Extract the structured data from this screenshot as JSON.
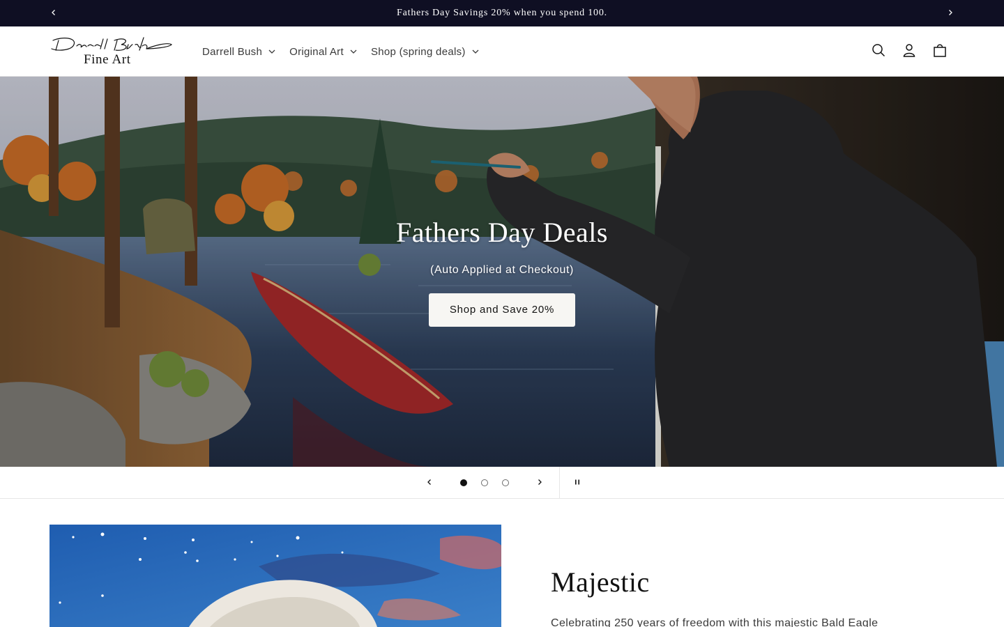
{
  "announcement": {
    "text": "Fathers Day Savings 20% when you spend 100.",
    "prev_icon": "chevron-left-icon",
    "next_icon": "chevron-right-icon"
  },
  "header": {
    "logo_script": "Darrell Bush",
    "logo_text": "Fine Art",
    "nav": [
      {
        "label": "Darrell Bush"
      },
      {
        "label": "Original Art"
      },
      {
        "label": "Shop (spring deals)"
      }
    ],
    "icons": [
      "search-icon",
      "account-icon",
      "cart-icon"
    ]
  },
  "hero": {
    "title": "Fathers Day Deals",
    "subtitle": "(Auto Applied at Checkout)",
    "button_label": "Shop and Save 20%"
  },
  "slider": {
    "slide_count": 3,
    "active_slide": 1,
    "icons": [
      "chevron-left-icon",
      "chevron-right-icon",
      "pause-icon"
    ]
  },
  "feature": {
    "title": "Majestic",
    "text": "Celebrating 250 years of freedom with this majestic Bald Eagle"
  },
  "colors": {
    "announcement_bg": "#0f0f23",
    "button_bg": "#f7f6f3",
    "text": "#121212"
  }
}
